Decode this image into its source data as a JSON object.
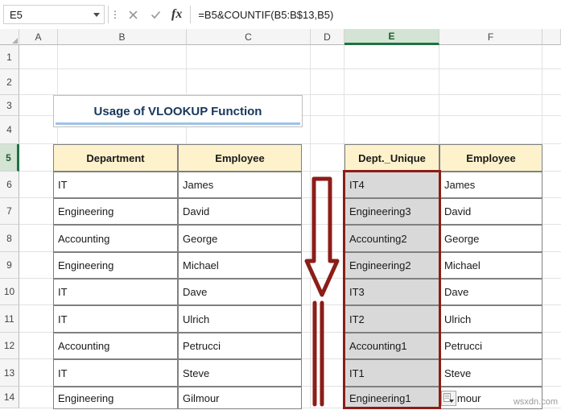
{
  "formula_bar": {
    "name_box_value": "E5",
    "formula_value": "=B5&COUNTIF(B5:B$13,B5)",
    "cancel_label": "✕",
    "confirm_label": "✓",
    "fx_label": "fx",
    "vertical_dots": "⋮"
  },
  "sheet": {
    "column_headers": [
      "A",
      "B",
      "C",
      "D",
      "E",
      "F"
    ],
    "selected_column": "E",
    "row_headers": [
      "1",
      "2",
      "3",
      "4",
      "5",
      "6",
      "7",
      "8",
      "9",
      "10",
      "11",
      "12",
      "13",
      "14"
    ],
    "selected_row": "5",
    "title_banner": "Usage of VLOOKUP Function",
    "left_table": {
      "headers": [
        "Department",
        "Employee"
      ],
      "rows": [
        [
          "IT",
          "James"
        ],
        [
          "Engineering",
          "David"
        ],
        [
          "Accounting",
          "George"
        ],
        [
          "Engineering",
          "Michael"
        ],
        [
          "IT",
          "Dave"
        ],
        [
          "IT",
          "Ulrich"
        ],
        [
          "Accounting",
          "Petrucci"
        ],
        [
          "IT",
          "Steve"
        ],
        [
          "Engineering",
          "Gilmour"
        ]
      ]
    },
    "right_table": {
      "headers": [
        "Dept._Unique",
        "Employee"
      ],
      "rows": [
        [
          "IT4",
          "James"
        ],
        [
          "Engineering3",
          "David"
        ],
        [
          "Accounting2",
          "George"
        ],
        [
          "Engineering2",
          "Michael"
        ],
        [
          "IT3",
          "Dave"
        ],
        [
          "IT2",
          "Ulrich"
        ],
        [
          "Accounting1",
          "Petrucci"
        ],
        [
          "IT1",
          "Steve"
        ],
        [
          "Engineering1",
          "Gilmour"
        ]
      ]
    }
  },
  "annotations": {
    "highlight_color": "#8c1d18",
    "arrow_color": "#8c1d18",
    "header_fill": "#fdf2cc",
    "gray_fill": "#d9d9d9",
    "accent_color": "#1e7145",
    "watermark": "wsxdn.com"
  }
}
